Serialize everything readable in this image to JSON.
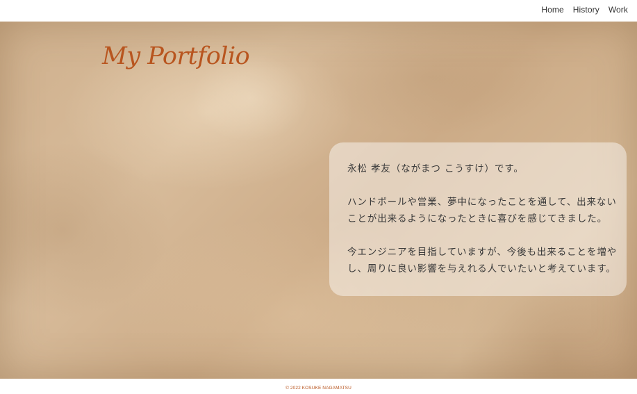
{
  "nav": {
    "items": [
      {
        "label": "Home"
      },
      {
        "label": "History"
      },
      {
        "label": "Work"
      }
    ]
  },
  "hero": {
    "title": "My Portfolio"
  },
  "intro": {
    "line_1": "永松 孝友（ながまつ こうすけ）です。",
    "line_2a": "ハンドボールや営業、夢中になったことを通して、出来ない",
    "line_2b": "ことが出来るようになったときに喜びを感じてきました。",
    "line_3a": "今エンジニアを目指していますが、今後も出来ることを増や",
    "line_3b": "し、周りに良い影響を与えれる人でいたいと考えています。"
  },
  "footer": {
    "copyright": "© 2022 KOSUKE NAGAMATSU"
  },
  "colors": {
    "accent": "#b8551f",
    "card_background": "rgba(255,255,255,0.45)",
    "nav_text": "#333333",
    "body_text": "#3a3a3a"
  }
}
